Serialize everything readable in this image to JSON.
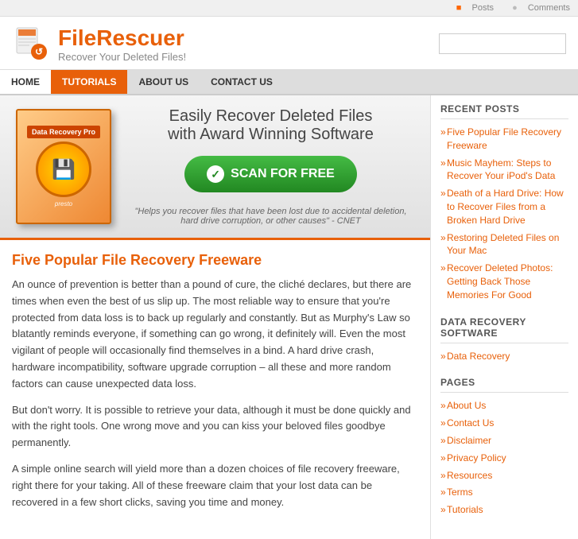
{
  "topbar": {
    "posts_label": "Posts",
    "comments_label": "Comments"
  },
  "header": {
    "logo_name": "FileRescuer",
    "tagline": "Recover Your Deleted Files!",
    "search_placeholder": ""
  },
  "nav": {
    "items": [
      {
        "label": "HOME",
        "state": "active"
      },
      {
        "label": "TUTORIALS",
        "state": "orange"
      },
      {
        "label": "ABOUT US",
        "state": "normal"
      },
      {
        "label": "CONTACT US",
        "state": "normal"
      }
    ]
  },
  "banner": {
    "box_title": "Data Recovery Pro",
    "box_subtitle": "presto",
    "headline_line1": "Easily Recover Deleted Files",
    "headline_line2": "with Award Winning Software",
    "scan_button": "SCAN FOR FREE",
    "quote": "\"Helps you recover files that have been lost due to accidental deletion, hard drive corruption, or other causes\" - CNET"
  },
  "article": {
    "title": "Five Popular File Recovery Freeware",
    "paragraphs": [
      "An ounce of prevention is better than a pound of cure, the cliché declares, but there are times when even the best of us slip up. The most reliable way to ensure that you're protected from data loss is to back up regularly and constantly. But as Murphy's Law so blatantly reminds everyone, if something can go wrong, it definitely will. Even the most vigilant of people will occasionally find themselves in a bind. A hard drive crash, hardware incompatibility, software upgrade corruption – all these and more random factors can cause unexpected data loss.",
      "But don't worry. It is possible to retrieve your data, although it must be done quickly and with the right tools. One wrong move and you can kiss your beloved files goodbye permanently.",
      "A simple online search will yield more than a dozen choices of file recovery freeware, right there for your taking. All of these freeware claim that your lost data can be recovered in a few short clicks, saving you time and money."
    ]
  },
  "sidebar": {
    "recent_posts_title": "RECENT POSTS",
    "recent_posts": [
      "Five Popular File Recovery Freeware",
      "Music Mayhem: Steps to Recover Your iPod's Data",
      "Death of a Hard Drive: How to Recover Files from a Broken Hard Drive",
      "Restoring Deleted Files on Your Mac",
      "Recover Deleted Photos: Getting Back Those Memories For Good"
    ],
    "data_recovery_title": "DATA RECOVERY SOFTWARE",
    "data_recovery_links": [
      "Data Recovery"
    ],
    "pages_title": "PAGES",
    "pages_links": [
      "About Us",
      "Contact Us",
      "Disclaimer",
      "Privacy Policy",
      "Resources",
      "Terms",
      "Tutorials"
    ]
  }
}
